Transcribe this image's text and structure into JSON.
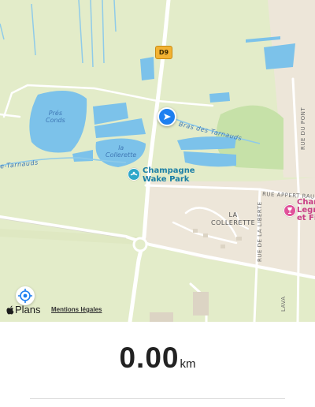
{
  "map": {
    "road_shield": "D9",
    "water_labels": [
      "Prés\nConds",
      "la\nCollerette"
    ],
    "street_labels": {
      "bras_des_tarnauds": "Bras des Tarnauds",
      "tarnauds_left": "e-Tarnauds",
      "rue_appert": "RUE APPERT RAUL",
      "la_collerette": "LA\nCOLLERETTE",
      "rue_de_la_liberte": "RUE DE LA LIBERTE",
      "rue_du_pont": "RUE DU PONT",
      "rue_lava": "LAVA"
    },
    "pois": {
      "wake_park": "Champagne\nWake Park",
      "champagne": "Cham\nLegra\net Fil"
    },
    "colors": {
      "land": "#e3ecc9",
      "water": "#7cc2ea",
      "urban": "#ede6d9",
      "forest": "#c6e1a8",
      "road": "#ffffff",
      "location_blue": "#1d7ff0"
    }
  },
  "attribution": {
    "brand_icon": "apple-icon",
    "brand": "Plans",
    "legal": "Mentions légales"
  },
  "stats": {
    "distance_value": "0.00",
    "distance_unit": "km"
  }
}
